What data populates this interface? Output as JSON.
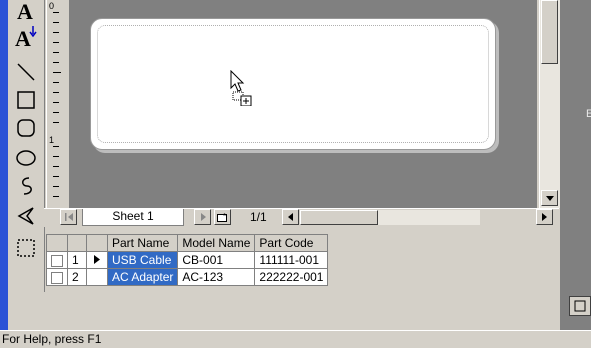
{
  "ruler": {
    "marks": [
      "0",
      "1"
    ]
  },
  "sheet_nav": {
    "tab_label": "Sheet 1",
    "page_indicator": "1/1"
  },
  "grid": {
    "headers": [
      "Part Name",
      "Model Name",
      "Part Code"
    ],
    "rows": [
      {
        "num": "1",
        "part_name": "USB Cable",
        "model_name": "CB-001",
        "part_code": "111111-001"
      },
      {
        "num": "2",
        "part_name": "AC Adapter",
        "model_name": "AC-123",
        "part_code": "222222-001"
      }
    ]
  },
  "right_panel": {
    "text": "E"
  },
  "status": {
    "text": "For Help, press F1"
  },
  "colors": {
    "selection": "#316ac5",
    "canvas": "#808080",
    "frame": "#2a52d6"
  },
  "icons": [
    "text-tool-icon",
    "vertical-text-tool-icon",
    "line-tool-icon",
    "rectangle-tool-icon",
    "rounded-rectangle-tool-icon",
    "ellipse-tool-icon",
    "freehand-tool-icon",
    "polygon-tool-icon",
    "selection-tool-icon",
    "cursor-icon"
  ]
}
